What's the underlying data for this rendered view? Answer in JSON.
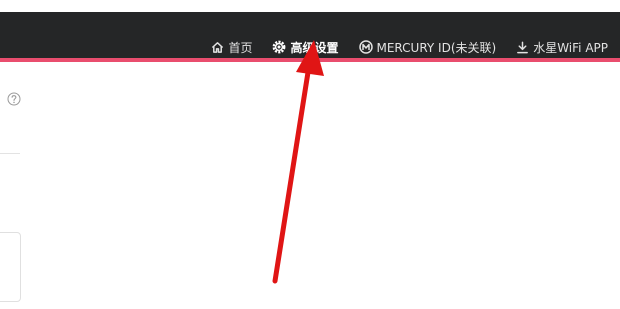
{
  "header": {
    "nav": [
      {
        "label": "首页",
        "icon": "home-icon"
      },
      {
        "label": "高级设置",
        "icon": "gear-icon",
        "active": true
      },
      {
        "label": "MERCURY ID(未关联)",
        "icon": "mercury-logo-icon"
      },
      {
        "label": "水星WiFi APP",
        "icon": "download-icon"
      }
    ],
    "colors": {
      "bar": "#252627",
      "accent": "#e94d6e"
    }
  },
  "page": {
    "help_icon": "question-circle-icon"
  },
  "annotation": {
    "icon": "red-arrow",
    "color": "#e01515"
  }
}
